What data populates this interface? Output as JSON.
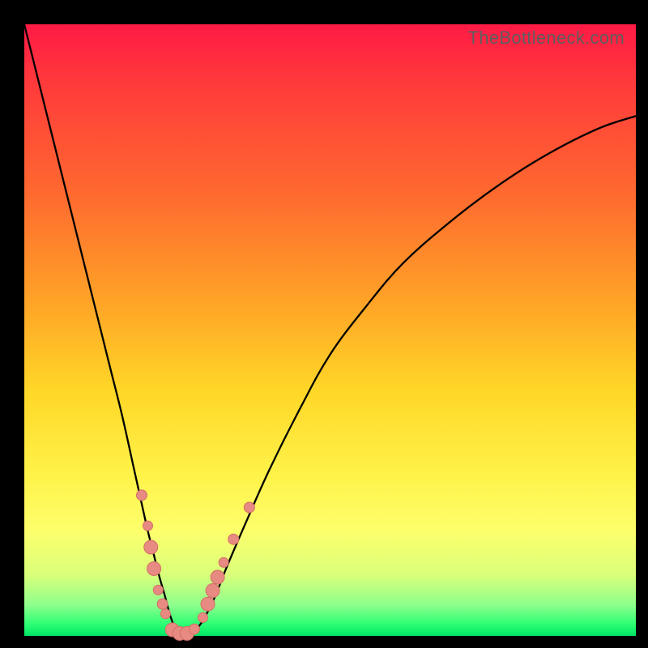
{
  "watermark": "TheBottleneck.com",
  "colors": {
    "marker_fill": "#e78a82",
    "marker_stroke": "#d46f67",
    "curve_stroke": "#000000"
  },
  "chart_data": {
    "type": "line",
    "title": "",
    "xlabel": "",
    "ylabel": "",
    "xlim": [
      0,
      100
    ],
    "ylim": [
      0,
      100
    ],
    "grid": false,
    "legend": false,
    "series": [
      {
        "name": "bottleneck_curve",
        "x": [
          0,
          2,
          4,
          6,
          8,
          10,
          12,
          14,
          16,
          18,
          20,
          21,
          22,
          23,
          23.8,
          24.6,
          25.4,
          26.4,
          27.6,
          29,
          31,
          33,
          36,
          40,
          45,
          50,
          56,
          62,
          70,
          78,
          86,
          94,
          100
        ],
        "y": [
          100,
          92,
          84,
          76,
          68,
          60,
          52,
          44,
          36,
          27,
          18,
          14,
          10,
          6.5,
          3.5,
          1.4,
          0.4,
          0.2,
          0.7,
          2.2,
          6,
          11,
          18,
          27,
          37,
          46,
          54,
          61,
          68,
          74,
          79,
          83,
          85
        ]
      }
    ],
    "markers": [
      {
        "x": 19.2,
        "y": 23,
        "rpx": 6.5
      },
      {
        "x": 20.2,
        "y": 18,
        "rpx": 6.0
      },
      {
        "x": 20.7,
        "y": 14.5,
        "rpx": 8.5
      },
      {
        "x": 21.2,
        "y": 11,
        "rpx": 8.5
      },
      {
        "x": 21.9,
        "y": 7.5,
        "rpx": 6.0
      },
      {
        "x": 22.6,
        "y": 5.2,
        "rpx": 6.5
      },
      {
        "x": 23.1,
        "y": 3.6,
        "rpx": 6.0
      },
      {
        "x": 24.2,
        "y": 1.0,
        "rpx": 8.5
      },
      {
        "x": 25.4,
        "y": 0.4,
        "rpx": 8.5
      },
      {
        "x": 26.6,
        "y": 0.4,
        "rpx": 8.5
      },
      {
        "x": 27.8,
        "y": 1.1,
        "rpx": 6.5
      },
      {
        "x": 29.2,
        "y": 3.0,
        "rpx": 6.0
      },
      {
        "x": 30.0,
        "y": 5.2,
        "rpx": 8.5
      },
      {
        "x": 30.8,
        "y": 7.4,
        "rpx": 8.5
      },
      {
        "x": 31.6,
        "y": 9.6,
        "rpx": 8.5
      },
      {
        "x": 32.6,
        "y": 12.0,
        "rpx": 6.0
      },
      {
        "x": 34.2,
        "y": 15.8,
        "rpx": 6.5
      },
      {
        "x": 36.8,
        "y": 21.0,
        "rpx": 6.5
      }
    ]
  }
}
